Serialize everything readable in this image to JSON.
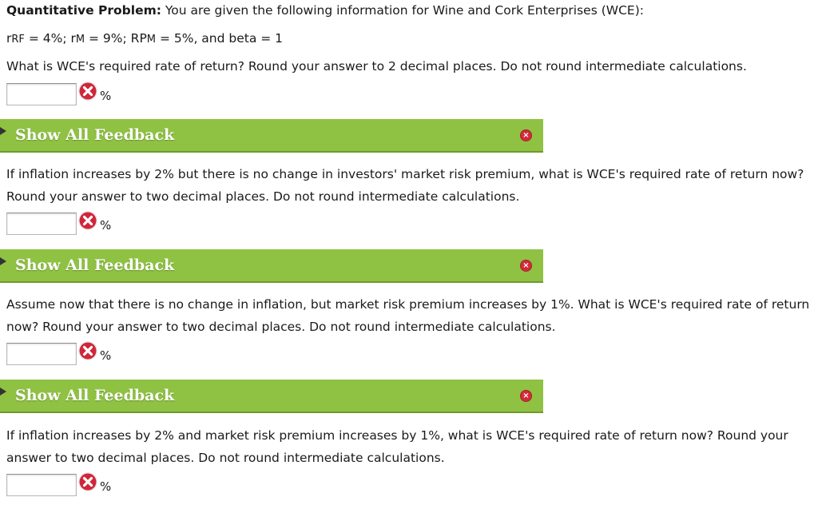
{
  "problem": {
    "heading": "Quantitative Problem:",
    "intro": " You are given the following information for Wine and Cork Enterprises (WCE):",
    "given": {
      "rrf_sym": "r",
      "rrf_sub": "RF",
      "rrf_val": " = 4%; ",
      "rm_sym": "r",
      "rm_sub": "M",
      "rm_val": " = 9%; ",
      "rpm_sym": "RP",
      "rpm_sub": "M",
      "rpm_val": " = 5%, and beta = 1"
    }
  },
  "feedback_label": "Show All Feedback",
  "percent": "%",
  "questions": [
    {
      "text": "What is WCE's required rate of return? Round your answer to 2 decimal places. Do not round intermediate calculations.",
      "value": ""
    },
    {
      "text": "If inflation increases by 2% but there is no change in investors' market risk premium, what is WCE's required rate of return now? Round your answer to two decimal places. Do not round intermediate calculations.",
      "value": ""
    },
    {
      "text": "Assume now that there is no change in inflation, but market risk premium increases by 1%. What is WCE's required rate of return now? Round your answer to two decimal places. Do not round intermediate calculations.",
      "value": ""
    },
    {
      "text": "If inflation increases by 2% and market risk premium increases by 1%, what is WCE's required rate of return now? Round your answer to two decimal places. Do not round intermediate calculations.",
      "value": ""
    }
  ],
  "colors": {
    "feedback_bar": "#8fc143",
    "error_icon": "#d22b3a"
  },
  "icons": {
    "answer_status": "incorrect-x-icon",
    "feedback_toggle": "expand-triangle-icon",
    "feedback_close": "close-x-icon"
  }
}
